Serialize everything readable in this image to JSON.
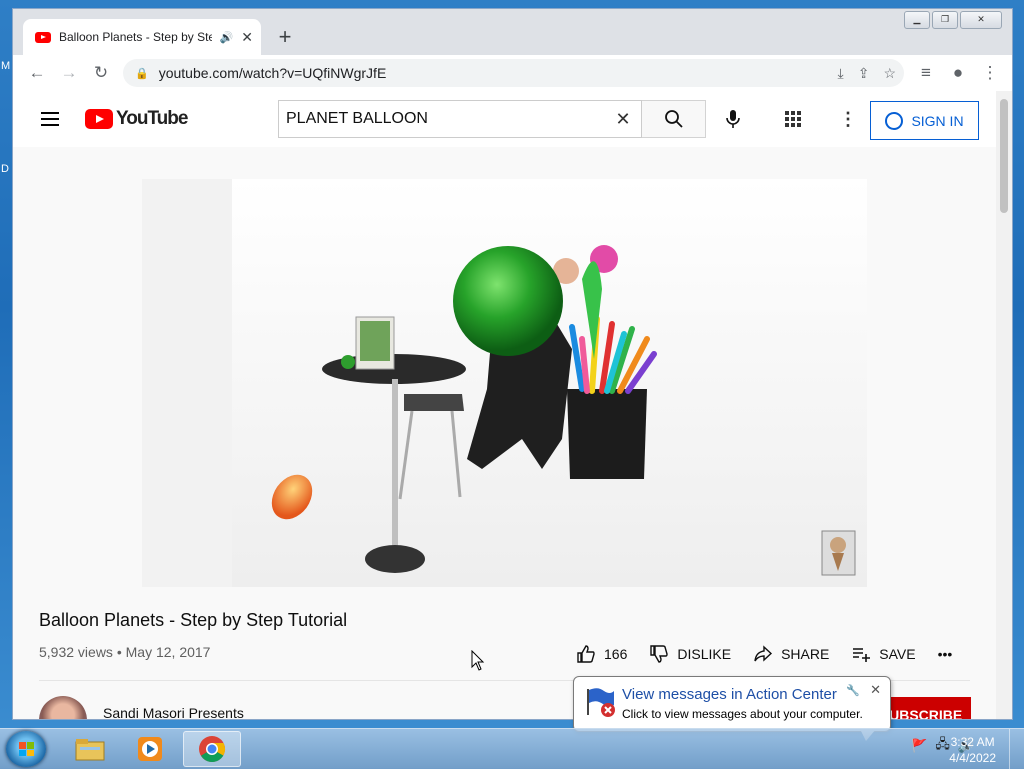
{
  "desktop": {
    "labels": [
      "M",
      "D"
    ]
  },
  "browser": {
    "tab": {
      "title": "Balloon Planets - Step by Ste",
      "audio_icon": "speaker-icon",
      "close": "✕"
    },
    "new_tab": "+",
    "window_controls": [
      "minimize",
      "maximize",
      "close"
    ],
    "url": "youtube.com/watch?v=UQfiNWgrJfE"
  },
  "youtube": {
    "logo_text": "YouTube",
    "search": {
      "value": "PLANET BALLOON",
      "clear": "✕"
    },
    "sign_in": "SIGN IN",
    "video": {
      "title": "Balloon Planets - Step by Step Tutorial",
      "views": "5,932 views",
      "date": "May 12, 2017",
      "meta_separator": "•"
    },
    "actions": {
      "likes": "166",
      "dislike": "DISLIKE",
      "share": "SHARE",
      "save": "SAVE",
      "more": "•••"
    },
    "channel": {
      "name": "Sandi Masori Presents",
      "subscribe": "SUBSCRIBE"
    }
  },
  "notification": {
    "title": "View messages in Action Center",
    "text": "Click to view messages about your computer."
  },
  "taskbar": {
    "items": [
      "windows-explorer",
      "media-player",
      "chrome"
    ],
    "time": "3:32 AM",
    "date": "4/4/2022"
  },
  "colors": {
    "yt_red": "#ff0000",
    "link_blue": "#065fd4",
    "subscribe_red": "#cc0000"
  }
}
